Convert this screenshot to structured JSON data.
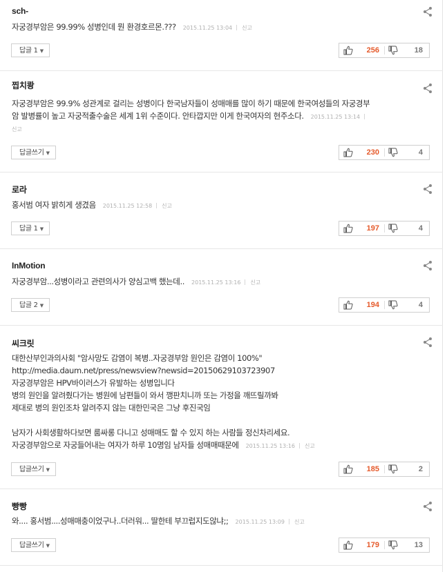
{
  "comments": [
    {
      "author": "sch-",
      "text": "자궁경부암은 99.99% 성병인데 뭔 환경호르몬.???",
      "date": "2015.11.25 13:04",
      "report": "신고",
      "reply_label": "답글 1",
      "up": "256",
      "down": "18"
    },
    {
      "author": "찝치쾅",
      "text": "자궁경부암은 99.9% 성관계로 걸리는 성병이다 한국남자들이 성매매를 많이 하기 때문에 한국여성들의 자궁경부\n암 발병률이 높고 자궁적출수술은 세계 1위 수준이다. 안타깝지만 이게 한국여자의 현주소다.",
      "date": "2015.11.25 13:14",
      "report": "신고",
      "reply_label": "답글쓰기",
      "up": "230",
      "down": "4"
    },
    {
      "author": "로라",
      "text": "홍서범 여자 밝히게 생겼음",
      "date": "2015.11.25 12:58",
      "report": "신고",
      "reply_label": "답글 1",
      "up": "197",
      "down": "4"
    },
    {
      "author": "InMotion",
      "text": "자궁경부암...성병이라고 관련의사가 양심고백 했는데..",
      "date": "2015.11.25 13:16",
      "report": "신고",
      "reply_label": "답글 2",
      "up": "194",
      "down": "4"
    },
    {
      "author": "씨크릿",
      "text": "대한산부인과의사회 \"암사망도 감염이 복병..자궁경부암 원인은 감염이 100%\"\nhttp://media.daum.net/press/newsview?newsid=20150629103723907\n자궁경부암은 HPV바이러스가 유발하는 성병입니다\n병의 원인을 알려줬다가는 병원에 남편들이 와서 깽판치니까 또는 가정을 깨뜨릴까봐\n제대로 병의 원인조차 알려주지 않는 대한민국은 그냥 후진국임\n\n남자가 사회생활하다보면 룸싸롱 다니고 성매매도 할 수 있지 하는 사람들 정신차리세요.\n자궁경부암으로 자궁들어내는 여자가 하루 10명임 남자들 성매매때문에",
      "date": "2015.11.25 13:16",
      "report": "신고",
      "reply_label": "답글쓰기",
      "up": "185",
      "down": "2"
    },
    {
      "author": "빵빵",
      "text": "와.... 홍서범....성매매충이었구나..더러워... 딸한테 부끄럽지도않냐;;",
      "date": "2015.11.25 13:09",
      "report": "신고",
      "reply_label": "답글쓰기",
      "up": "179",
      "down": "13"
    }
  ],
  "icons": {
    "share": "share-icon",
    "up": "thumbs-up-icon",
    "down": "thumbs-down-icon",
    "caret": "caret-down-icon"
  },
  "colors": {
    "up_count": "#e55a2b",
    "down_count": "#777777"
  }
}
